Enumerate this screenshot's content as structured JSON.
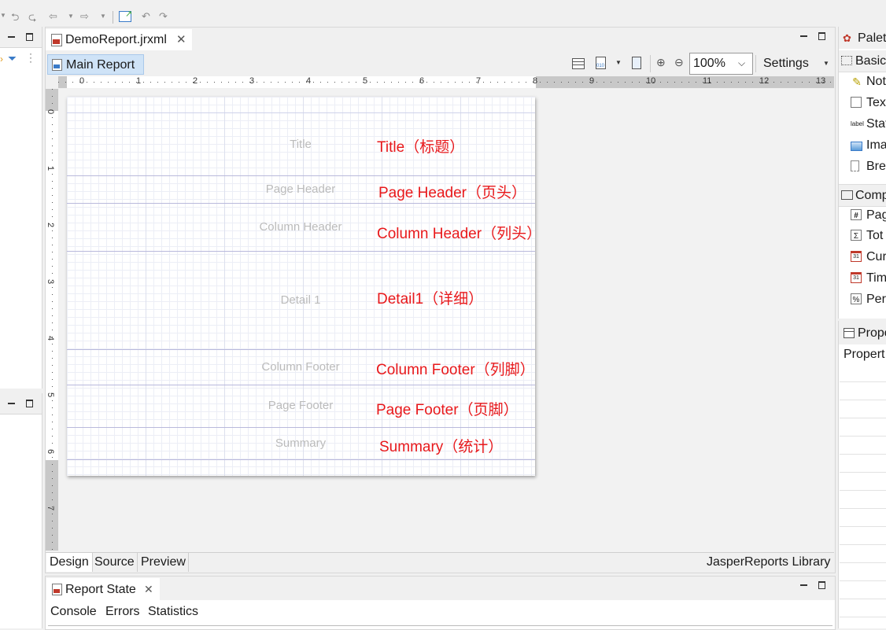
{
  "toolbar": {
    "icons": [
      "undo-prev-icon",
      "redo-next-icon",
      "back-icon",
      "forward-icon",
      "new-editor-icon",
      "undo-icon",
      "redo-icon"
    ]
  },
  "editor": {
    "tab_title": "DemoReport.jrxml",
    "main_report_label": "Main Report",
    "zoom_value": "100%",
    "settings_label": "Settings",
    "bottom_tabs": [
      "Design",
      "Source",
      "Preview"
    ],
    "library_label": "JasperReports Library"
  },
  "ruler": {
    "horizontal": [
      "0",
      "1",
      "2",
      "3",
      "4",
      "5",
      "6",
      "7",
      "8",
      "9",
      "10",
      "11",
      "12",
      "13"
    ],
    "vertical": [
      "0",
      "1",
      "2",
      "3",
      "4",
      "5",
      "6",
      "7"
    ]
  },
  "bands": [
    {
      "label": "Title",
      "annotation": "Title（标题）"
    },
    {
      "label": "Page Header",
      "annotation": "Page Header（页头）"
    },
    {
      "label": "Column Header",
      "annotation": "Column Header（列头）"
    },
    {
      "label": "Detail 1",
      "annotation": "Detail1（详细）"
    },
    {
      "label": "Column Footer",
      "annotation": "Column Footer（列脚）"
    },
    {
      "label": "Page Footer",
      "annotation": "Page Footer（页脚）"
    },
    {
      "label": "Summary",
      "annotation": "Summary（统计）"
    }
  ],
  "report_state": {
    "tab_title": "Report State",
    "tabs": [
      "Console",
      "Errors",
      "Statistics"
    ]
  },
  "palette": {
    "title": "Palet",
    "basic_group": "Basic",
    "basic_items": [
      {
        "label": "Not",
        "icon": "note-icon"
      },
      {
        "label": "Tex",
        "icon": "text-field-icon"
      },
      {
        "label": "Stat",
        "icon": "static-text-icon"
      },
      {
        "label": "Ima",
        "icon": "image-icon"
      },
      {
        "label": "Bre",
        "icon": "break-icon"
      }
    ],
    "composite_group": "Comp",
    "composite_items": [
      {
        "label": "Pag",
        "icon": "page-number-icon"
      },
      {
        "label": "Tot",
        "icon": "total-icon"
      },
      {
        "label": "Cur",
        "icon": "current-date-icon"
      },
      {
        "label": "Tim",
        "icon": "time-icon"
      },
      {
        "label": "Per",
        "icon": "percentage-icon"
      }
    ]
  },
  "properties": {
    "title": "Propo",
    "subtitle": "Propert"
  },
  "colors": {
    "annotation": "#e8181b",
    "band_line": "#b9b9dc",
    "selected_tab": "#cfe3f7"
  }
}
